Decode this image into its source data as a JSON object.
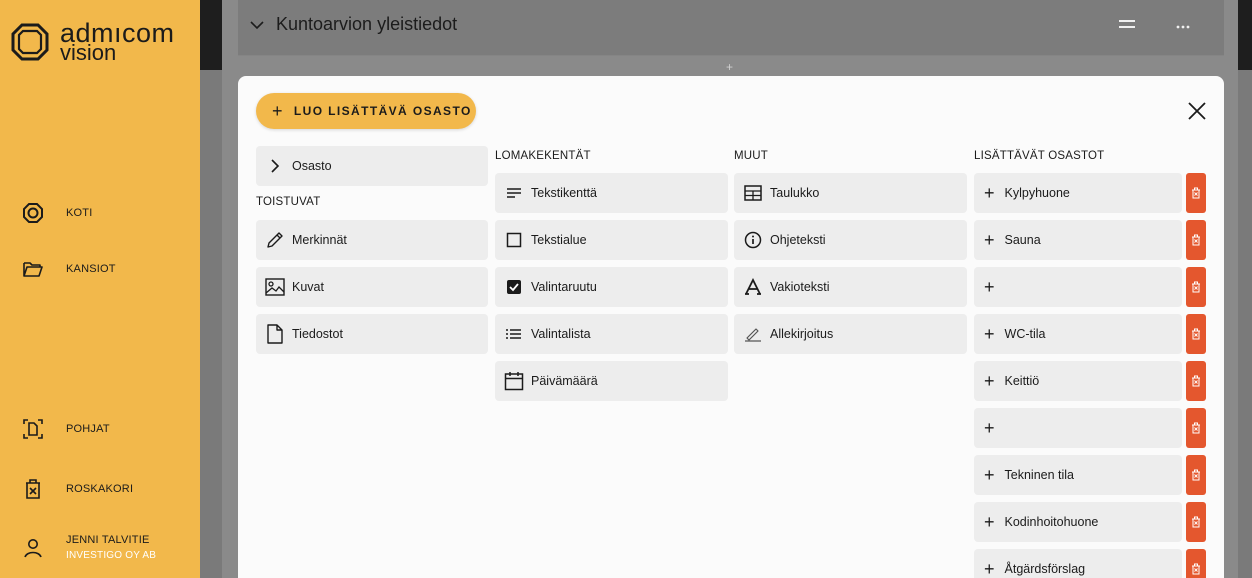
{
  "sidebar": {
    "logo": {
      "line1": "admıcom",
      "line2": "vision"
    },
    "items": [
      {
        "label": "KOTI",
        "icon": "home-icon"
      },
      {
        "label": "KANSIOT",
        "icon": "folder-icon"
      },
      {
        "label": "POHJAT",
        "icon": "template-icon"
      },
      {
        "label": "ROSKAKORI",
        "icon": "trash-icon"
      }
    ],
    "user": {
      "name": "JENNI TALVITIE",
      "company": "INVESTIGO OY AB",
      "icon": "user-icon"
    }
  },
  "background": {
    "section_title": "Kuntoarvion yleistiedot",
    "add_hint": "+"
  },
  "modal": {
    "add_button_label": "LUO LISÄTTÄVÄ OSASTO",
    "left": {
      "section_tile": "Osasto",
      "heading": "TOISTUVAT",
      "items": [
        {
          "label": "Merkinnät",
          "icon": "pencil-icon"
        },
        {
          "label": "Kuvat",
          "icon": "image-icon"
        },
        {
          "label": "Tiedostot",
          "icon": "file-icon"
        }
      ]
    },
    "form_fields": {
      "heading": "LOMAKEKENTÄT",
      "items": [
        {
          "label": "Tekstikenttä",
          "icon": "text-lines-icon"
        },
        {
          "label": "Tekstialue",
          "icon": "square-icon"
        },
        {
          "label": "Valintaruutu",
          "icon": "checkbox-icon"
        },
        {
          "label": "Valintalista",
          "icon": "list-icon"
        },
        {
          "label": "Päivämäärä",
          "icon": "calendar-icon"
        }
      ]
    },
    "other": {
      "heading": "MUUT",
      "items": [
        {
          "label": "Taulukko",
          "icon": "table-icon"
        },
        {
          "label": "Ohjeteksti",
          "icon": "info-icon"
        },
        {
          "label": "Vakioteksti",
          "icon": "serif-a-icon"
        },
        {
          "label": "Allekirjoitus",
          "icon": "signature-icon"
        }
      ]
    },
    "extra_sections": {
      "heading": "LISÄTTÄVÄT OSASTOT",
      "items": [
        {
          "label": "Kylpyhuone"
        },
        {
          "label": "Sauna"
        },
        {
          "label": ""
        },
        {
          "label": "WC-tila"
        },
        {
          "label": "Keittiö"
        },
        {
          "label": ""
        },
        {
          "label": "Tekninen tila"
        },
        {
          "label": "Kodinhoitohuone"
        },
        {
          "label": "Åtgärdsförslag"
        }
      ]
    }
  },
  "colors": {
    "accent": "#f2b84b",
    "danger": "#e4572e",
    "tile": "#ededed"
  }
}
